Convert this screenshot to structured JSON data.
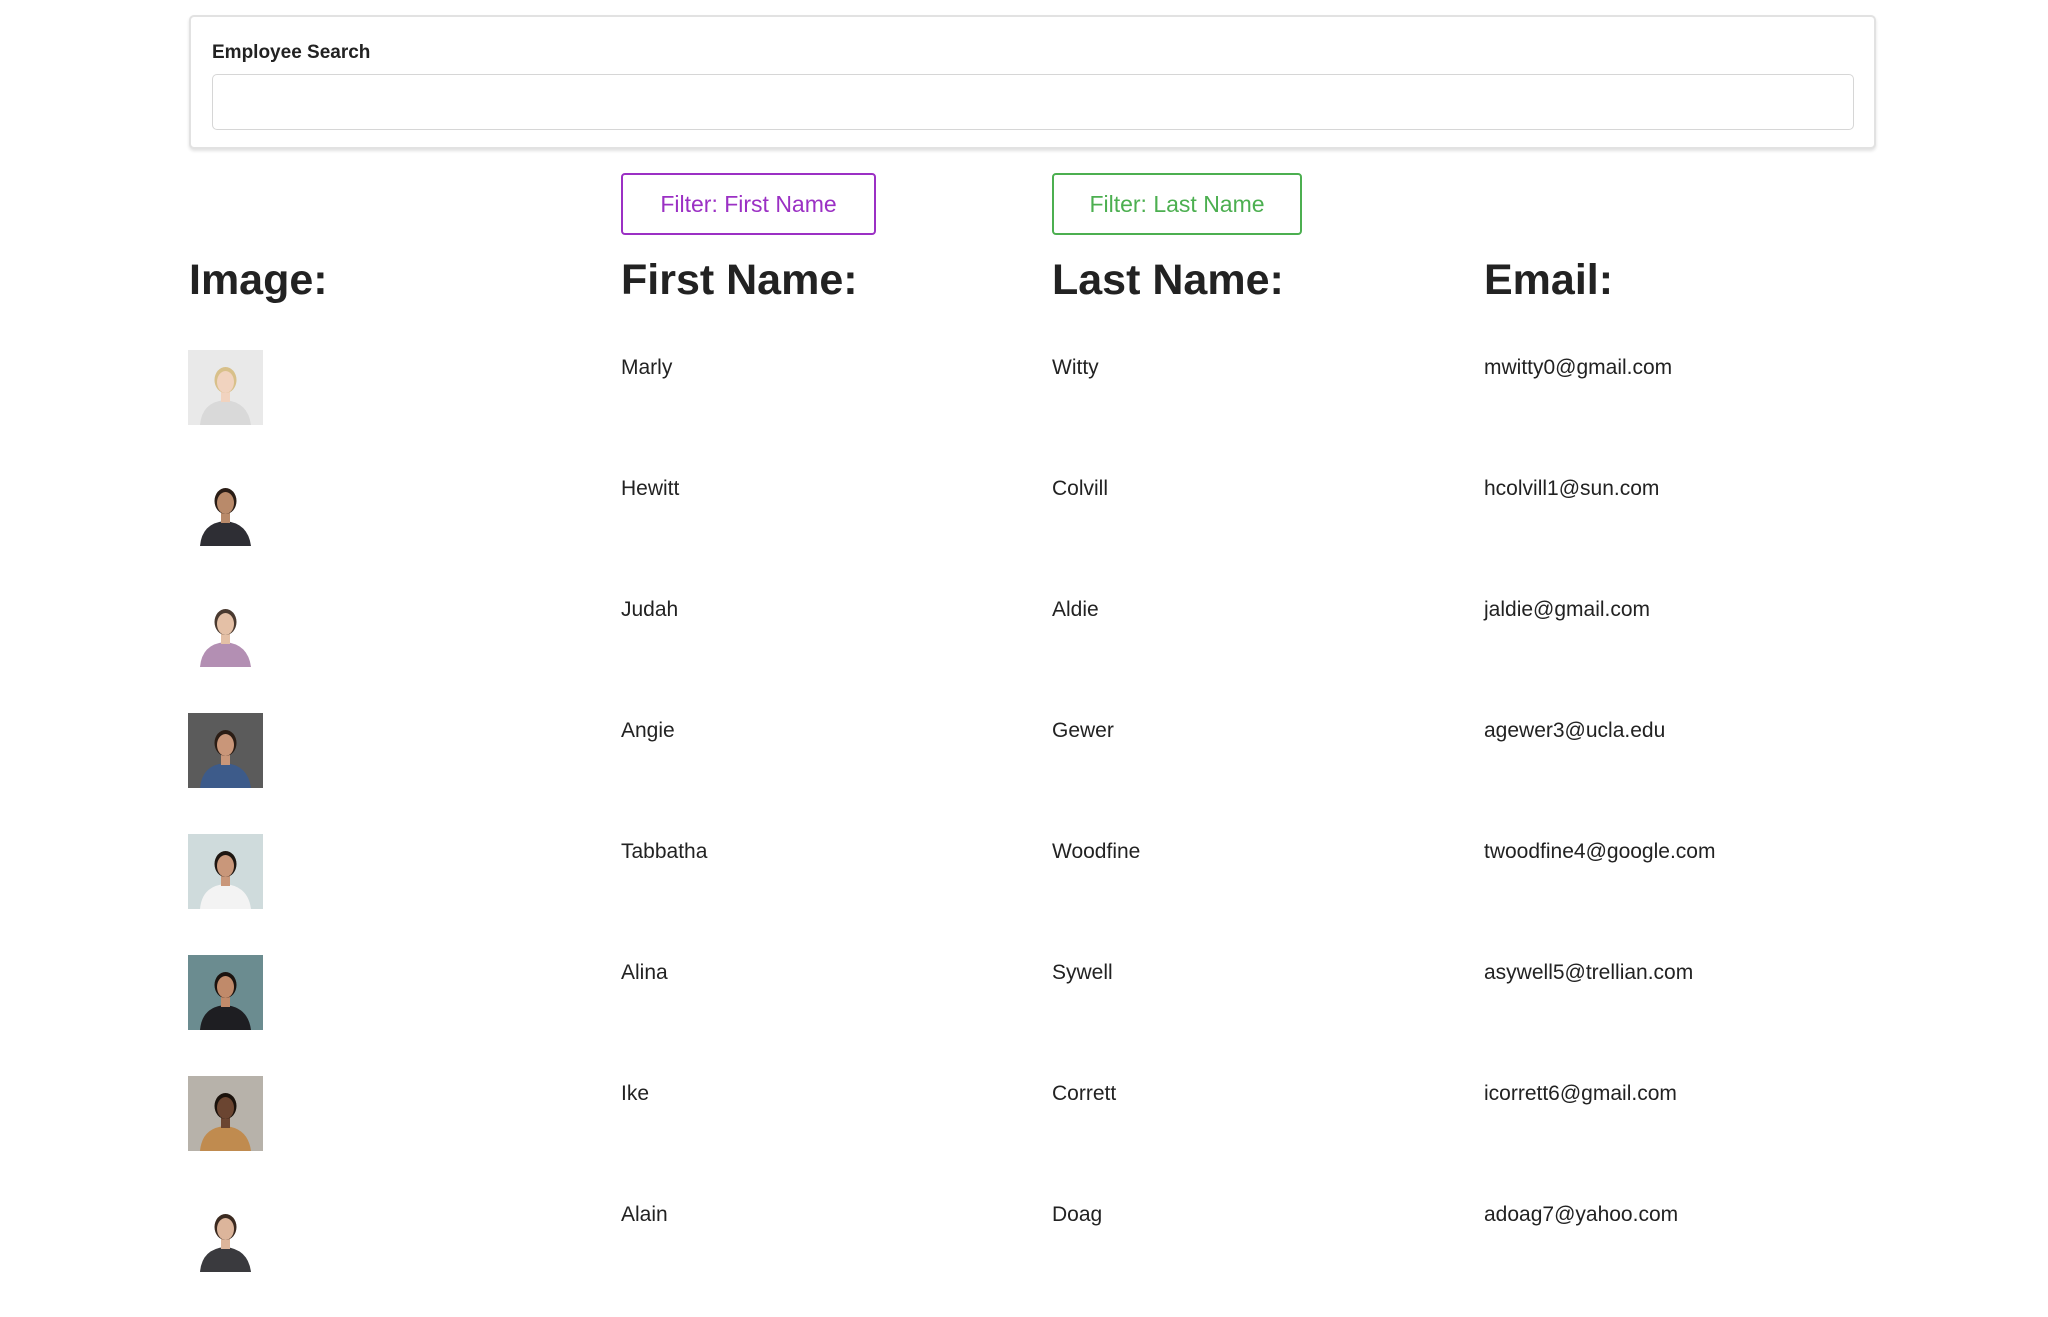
{
  "search": {
    "label": "Employee Search",
    "value": "",
    "placeholder": ""
  },
  "filters": {
    "first_label": "Filter: First Name",
    "last_label": "Filter: Last Name",
    "first_color": "#9b30c4",
    "last_color": "#4caf50"
  },
  "columns": {
    "image": "Image:",
    "first": "First Name:",
    "last": "Last Name:",
    "email": "Email:"
  },
  "employees": [
    {
      "first": "Marly",
      "last": "Witty",
      "email": "mwitty0@gmail.com",
      "photo": "woman-blonde-glasses-portrait"
    },
    {
      "first": "Hewitt",
      "last": "Colvill",
      "email": "hcolvill1@sun.com",
      "photo": "man-suit-tie-portrait"
    },
    {
      "first": "Judah",
      "last": "Aldie",
      "email": "jaldie@gmail.com",
      "photo": "man-plaid-shirt-portrait"
    },
    {
      "first": "Angie",
      "last": "Gewer",
      "email": "agewer3@ucla.edu",
      "photo": "woman-dark-hair-portrait"
    },
    {
      "first": "Tabbatha",
      "last": "Woodfine",
      "email": "twoodfine4@google.com",
      "photo": "woman-white-blouse-portrait"
    },
    {
      "first": "Alina",
      "last": "Sywell",
      "email": "asywell5@trellian.com",
      "photo": "woman-black-blazer-portrait"
    },
    {
      "first": "Ike",
      "last": "Corrett",
      "email": "icorrett6@gmail.com",
      "photo": "man-tan-sweater-portrait"
    },
    {
      "first": "Alain",
      "last": "Doag",
      "email": "adoag7@yahoo.com",
      "photo": "man-dark-shirt-portrait"
    }
  ]
}
